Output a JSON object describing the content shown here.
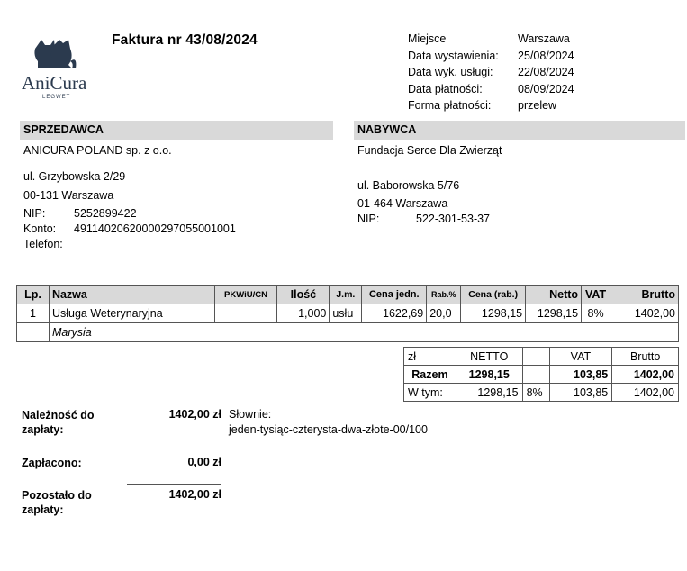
{
  "logo": {
    "name": "AniCura",
    "sub": "LEGWET"
  },
  "invoice": {
    "title": "Faktura nr  43/08/2024"
  },
  "meta": {
    "labels": [
      "Miejsce",
      "Data wystawienia:",
      "Data wyk. usługi:",
      "Data płatności:",
      "Forma płatności:"
    ],
    "values": [
      "Warszawa",
      "25/08/2024",
      "22/08/2024",
      "08/09/2024",
      "przelew"
    ]
  },
  "seller": {
    "header": "SPRZEDAWCA",
    "name": "ANICURA POLAND sp. z o.o.",
    "street": "ul. Grzybowska 2/29",
    "city": "00-131 Warszawa",
    "nip_label": "NIP:",
    "nip": "5252899422",
    "konto_label": "Konto:",
    "konto": "49114020620000297055001001",
    "telefon_label": "Telefon:"
  },
  "buyer": {
    "header": "NABYWCA",
    "name": "Fundacja Serce Dla Zwierząt",
    "street": "ul. Baborowska 5/76",
    "city": "01-464 Warszawa",
    "nip_label": "NIP:",
    "nip": "522-301-53-37"
  },
  "items": {
    "headers": [
      "Lp.",
      "Nazwa",
      "PKWiU/CN",
      "Ilość",
      "J.m.",
      "Cena jedn.",
      "Rab.%",
      "Cena (rab.)",
      "Netto",
      "VAT",
      "Brutto"
    ],
    "row": {
      "lp": "1",
      "nazwa": "Usługa Weterynaryjna",
      "pkwiu": "",
      "ilosc": "1,000",
      "jm": "usłu",
      "cena": "1622,69",
      "rab": "20,0",
      "cena_rab": "1298,15",
      "netto": "1298,15",
      "vat": "8%",
      "brutto": "1402,00"
    },
    "description": "Marysia"
  },
  "summary": {
    "headers": [
      "zł",
      "NETTO",
      "",
      "VAT",
      "Brutto"
    ],
    "razem": {
      "label": "Razem",
      "netto": "1298,15",
      "vat": "103,85",
      "brutto": "1402,00"
    },
    "wtym": {
      "label": "W tym:",
      "netto": "1298,15",
      "rate": "8%",
      "vat": "103,85",
      "brutto": "1402,00"
    }
  },
  "payment": {
    "due_label_1": "Należność do",
    "due_label_2": "zapłaty:",
    "due_value": "1402,00 zł",
    "words_label": "Słownie:",
    "words": "jeden-tysiąc-czterysta-dwa-złote-00/100",
    "paid_label": "Zapłacono:",
    "paid_value": "0,00 zł",
    "remaining_label_1": "Pozostało do",
    "remaining_label_2": "zapłaty:",
    "remaining_value": "1402,00 zł"
  },
  "colors": {
    "logo": "#2b3a4e",
    "header_bg": "#d9d9d9"
  }
}
